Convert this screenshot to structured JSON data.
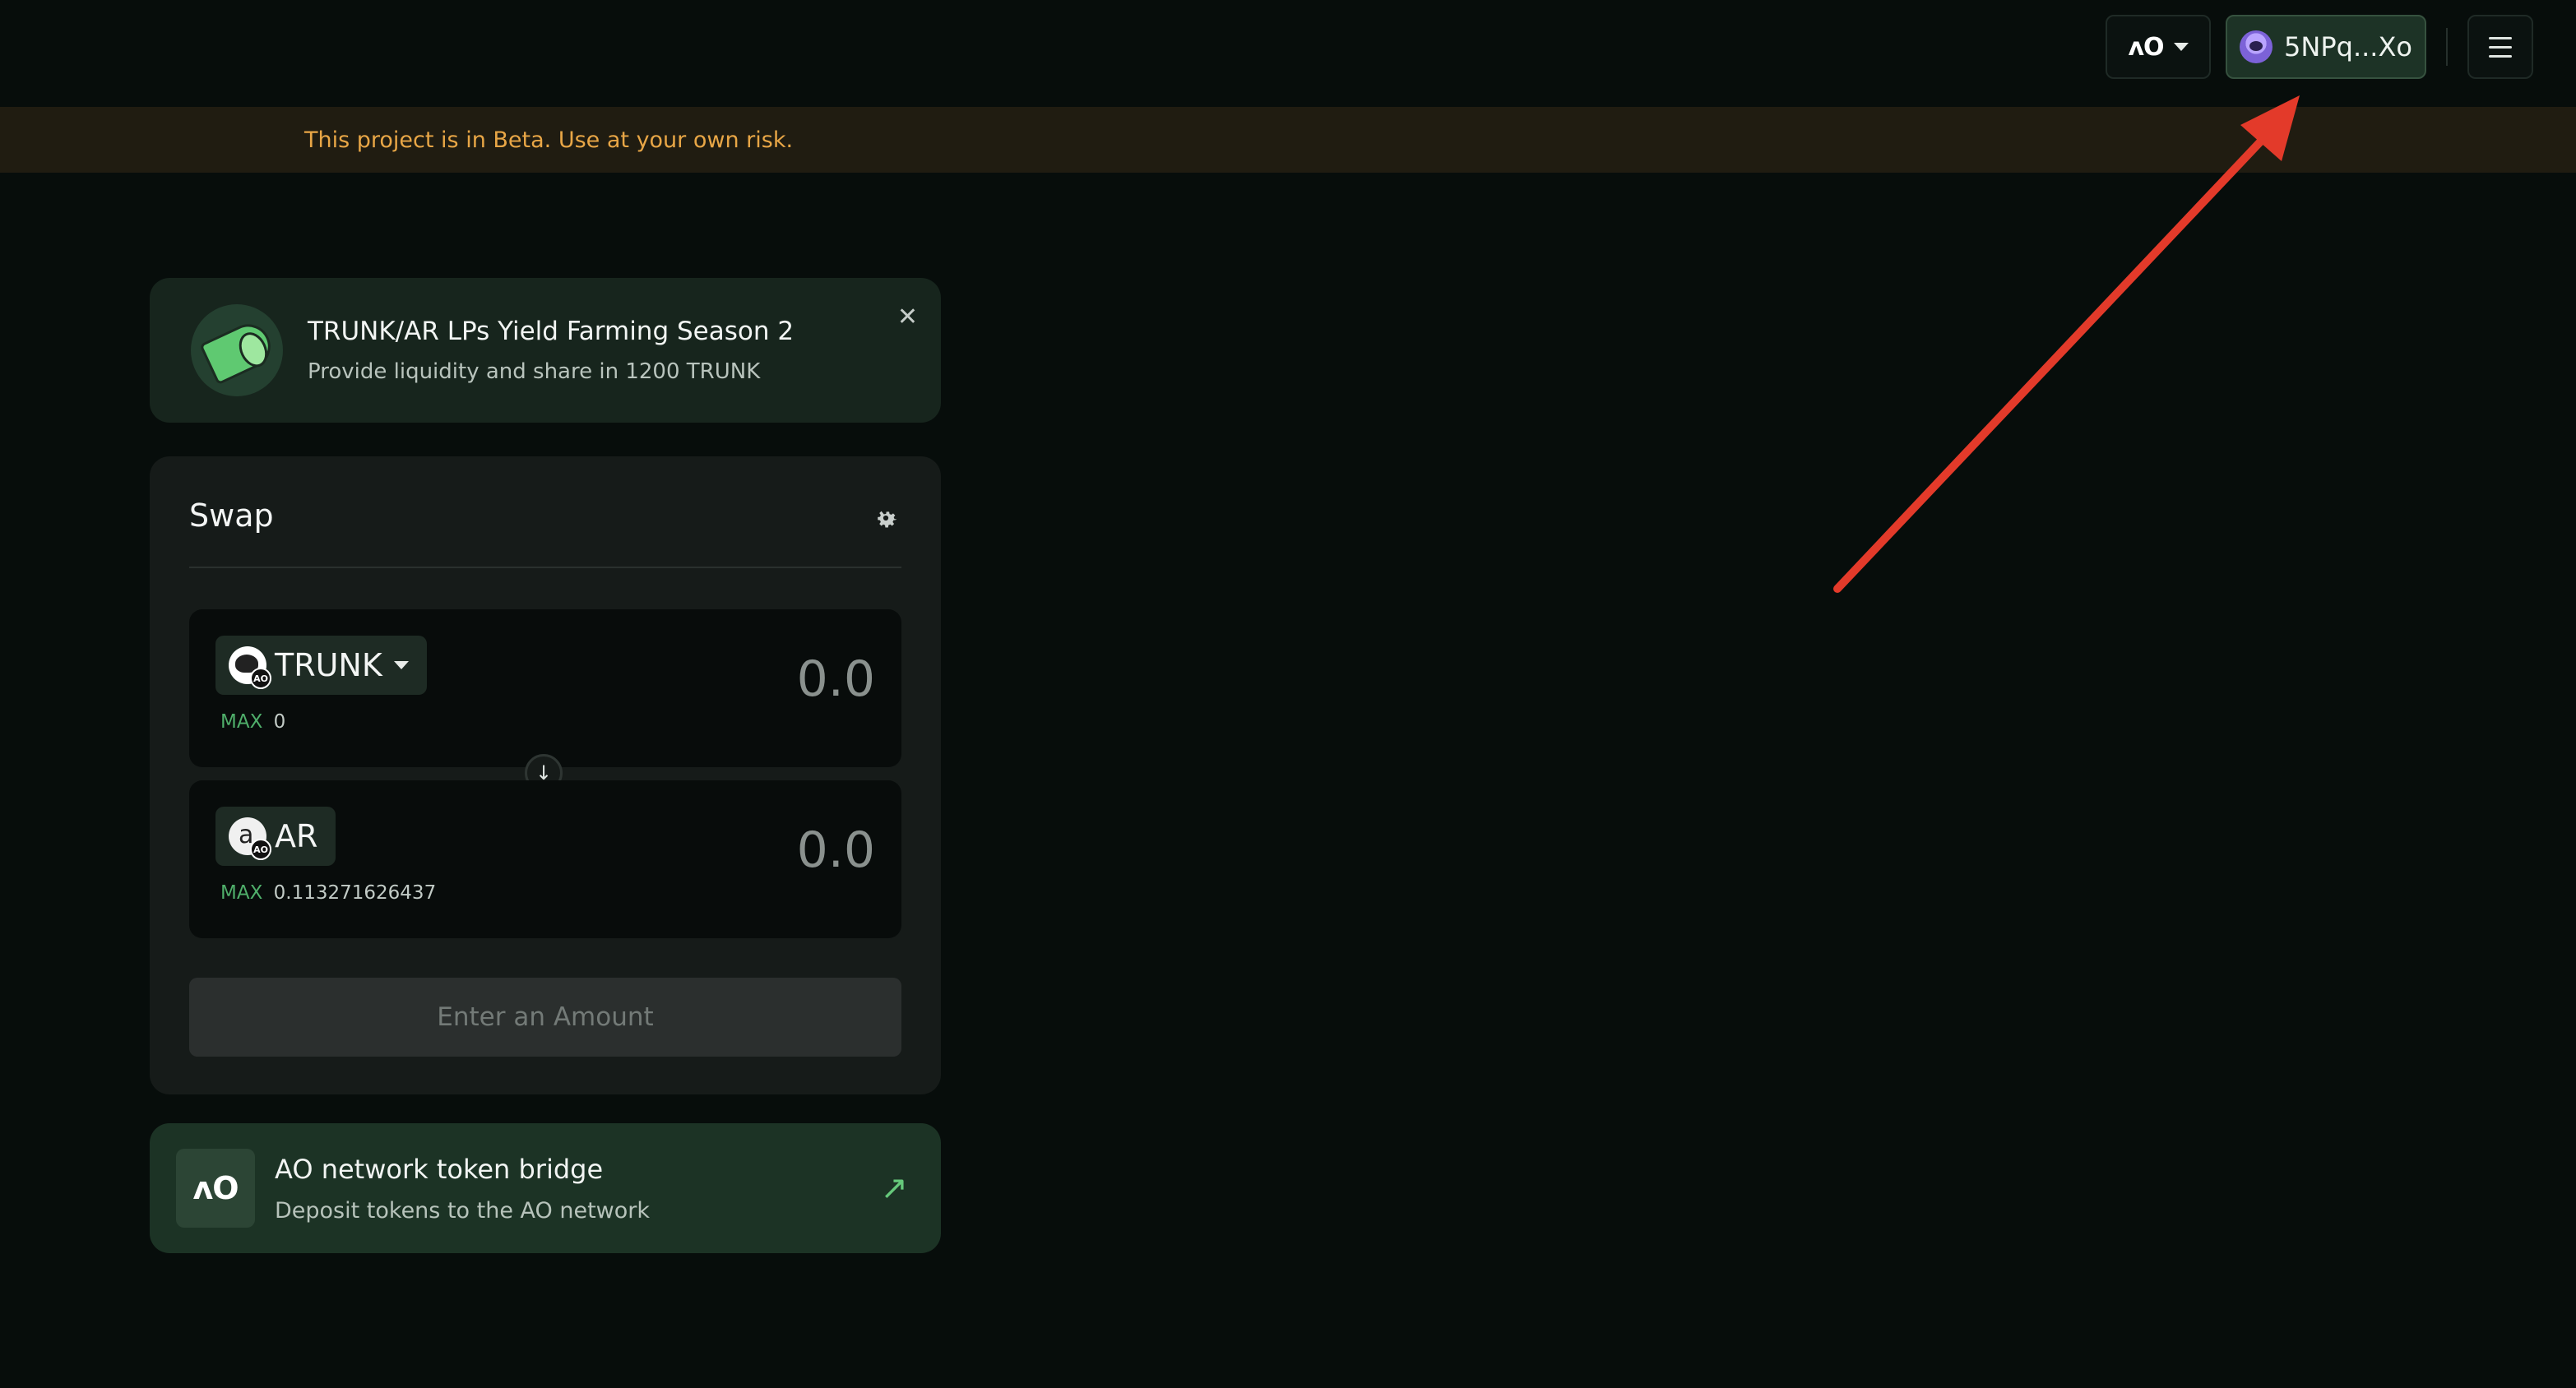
{
  "header": {
    "network_logo": "ʌO",
    "network_icon": "caret-down-icon",
    "wallet_address": "5NPq...Xo",
    "wallet_avatar_icon": "purple-avatar-icon",
    "menu_icon": "hamburger-menu-icon"
  },
  "beta_banner": {
    "text": "This project is in Beta. Use at your own risk."
  },
  "promo": {
    "icon": "megaphone-icon",
    "title": "TRUNK/AR LPs Yield Farming Season 2",
    "subtitle": "Provide liquidity and share in 1200 TRUNK",
    "close_icon": "close-icon"
  },
  "swap": {
    "title": "Swap",
    "settings_icon": "gear-icon",
    "from": {
      "token": "TRUNK",
      "token_badge": "AO",
      "max_label": "MAX",
      "max_value": "0",
      "amount": "0.0"
    },
    "to": {
      "token": "AR",
      "token_badge": "AO",
      "max_label": "MAX",
      "max_value": "0.113271626437",
      "amount": "0.0"
    },
    "switch_icon": "arrow-down-icon",
    "submit_label": "Enter an Amount"
  },
  "bridge": {
    "logo": "ʌO",
    "title": "AO network token bridge",
    "subtitle": "Deposit tokens to the AO network",
    "link_icon": "arrow-up-right-icon"
  },
  "colors": {
    "background": "#070d0b",
    "accent_green": "#4fae6a",
    "beta_text": "#e8a646",
    "annotation_arrow": "#e33a2a"
  }
}
